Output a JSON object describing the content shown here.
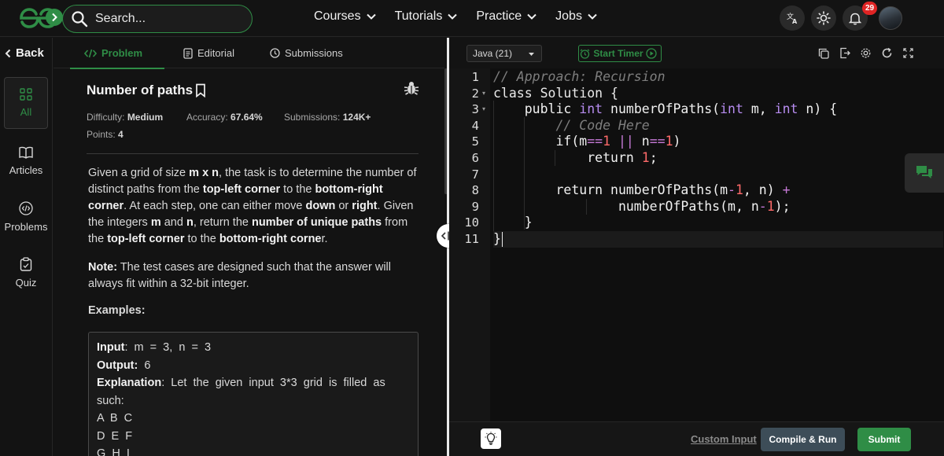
{
  "app": {
    "colors": {
      "brand": "#2f8d46",
      "bg": "#131313",
      "editor_bg": "#0f0f0f",
      "notify_badge": "#e02424",
      "compile_btn": "#3d4d58"
    }
  },
  "header": {
    "search_placeholder": "Search...",
    "nav": [
      {
        "label": "Courses"
      },
      {
        "label": "Tutorials"
      },
      {
        "label": "Practice"
      },
      {
        "label": "Jobs"
      }
    ],
    "notification_count": "29",
    "icons": [
      "logo-icon",
      "search-icon",
      "translate-icon",
      "theme-icon",
      "bell-icon",
      "avatar"
    ]
  },
  "rail": {
    "back_label": "Back",
    "items": [
      {
        "label": "All",
        "icon": "grid-icon"
      },
      {
        "label": "Articles",
        "icon": "book-icon"
      },
      {
        "label": "Problems",
        "icon": "code-icon"
      },
      {
        "label": "Quiz",
        "icon": "clipboard-icon"
      }
    ]
  },
  "problem": {
    "tabs": [
      {
        "label": "Problem",
        "icon": "code-tag-icon"
      },
      {
        "label": "Editorial",
        "icon": "document-icon"
      },
      {
        "label": "Submissions",
        "icon": "clock-icon"
      }
    ],
    "title": "Number of paths",
    "difficulty_label": "Difficulty:",
    "difficulty": "Medium",
    "accuracy_label": "Accuracy:",
    "accuracy": "67.64%",
    "submissions_label": "Submissions:",
    "submissions": "124K+",
    "points_label": "Points:",
    "points": "4",
    "description": {
      "p1": "Given a grid of size ",
      "b1": "m x n",
      "p2": ", the task is to determine the number of distinct paths from the ",
      "b2": "top-left corner",
      "p3": " to the ",
      "b3": "bottom-right corner",
      "p4": ". At each step, one can either move ",
      "b4": "down",
      "p5": " or ",
      "b5": "right",
      "p6": ". Given the integers ",
      "b6": "m",
      "p7": " and ",
      "b7": "n",
      "p8": ", return the ",
      "b8": "number of unique paths",
      "p9": " from the ",
      "b9": "top-left corner",
      "p10": " to the ",
      "b10": "bottom-right corne",
      "p11": "r."
    },
    "note_label": "Note:",
    "note_text": " The test cases are designed such that the answer will always fit within a 32-bit integer.",
    "examples_label": "Examples:",
    "example": {
      "input_label": "Input",
      "input": ":  m  =  3,  n  =  3",
      "output_label": "Output:",
      "output": "  6",
      "explanation_label": "Explanation",
      "explanation": ":  Let  the  given  input  3*3  grid  is  filled  as such:",
      "grid_rows": [
        "A  B  C",
        "D  E  F",
        "G  H  I"
      ]
    }
  },
  "editor": {
    "language": "Java (21)",
    "start_timer": "Start Timer",
    "line_numbers": [
      "1",
      "2",
      "3",
      "4",
      "5",
      "6",
      "7",
      "8",
      "9",
      "10",
      "11"
    ],
    "code_lines": [
      "// Approach: Recursion",
      "class Solution {",
      "    public int numberOfPaths(int m, int n) {",
      "        // Code Here",
      "        if(m==1 || n==1)",
      "            return 1;",
      "",
      "        return numberOfPaths(m-1, n) +",
      "                numberOfPaths(m, n-1);",
      "    }",
      "}"
    ],
    "custom_input": "Custom Input",
    "compile_run": "Compile & Run",
    "submit": "Submit"
  }
}
